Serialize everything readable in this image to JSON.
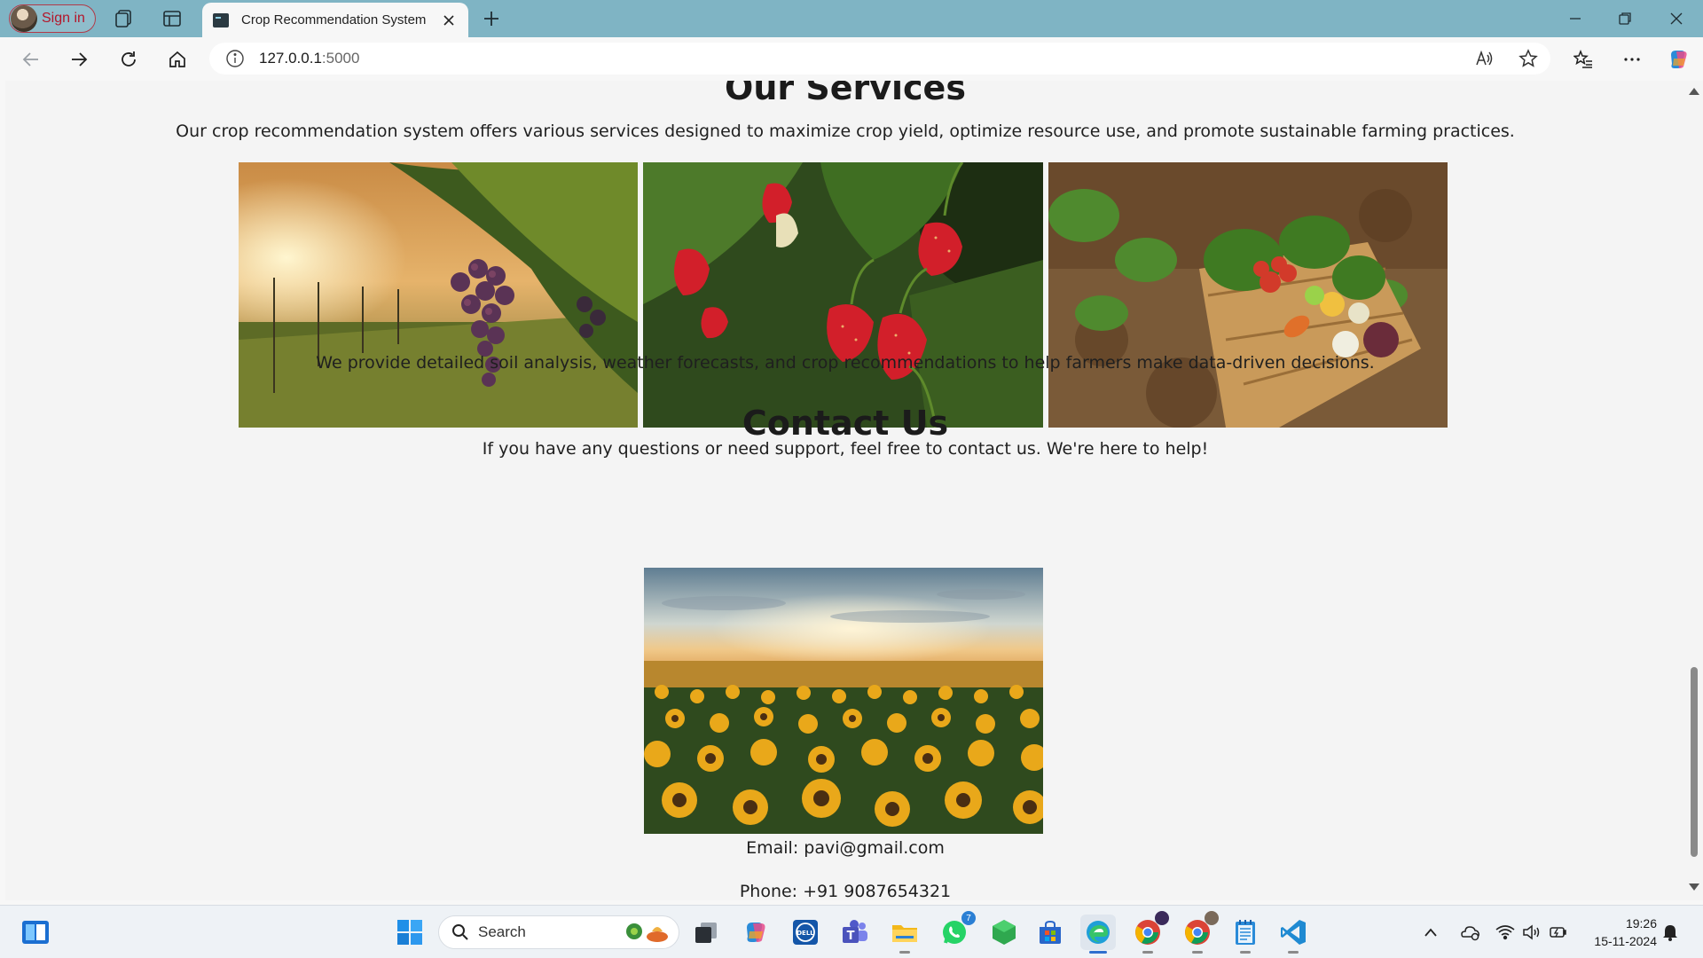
{
  "browser": {
    "signin_label": "Sign in",
    "tab_title": "Crop Recommendation System",
    "url_host": "127.0.0.1",
    "url_port": ":5000"
  },
  "page": {
    "services": {
      "heading": "Our Services",
      "intro": "Our crop recommendation system offers various services designed to maximize crop yield, optimize resource use, and promote sustainable farming practices.",
      "caption": "We provide detailed soil analysis, weather forecasts, and crop recommendations to help farmers make data-driven decisions."
    },
    "contact": {
      "heading": "Contact Us",
      "intro": "If you have any questions or need support, feel free to contact us. We're here to help!",
      "email": "Email: pavi@gmail.com",
      "phone": "Phone: +91 9087654321"
    }
  },
  "taskbar": {
    "search_label": "Search",
    "whatsapp_badge": "7",
    "time": "19:26",
    "date": "15-11-2024"
  },
  "colors": {
    "titlebar": "#7fb4c4",
    "accent": "#2f6fce",
    "signin": "#b3172b"
  }
}
